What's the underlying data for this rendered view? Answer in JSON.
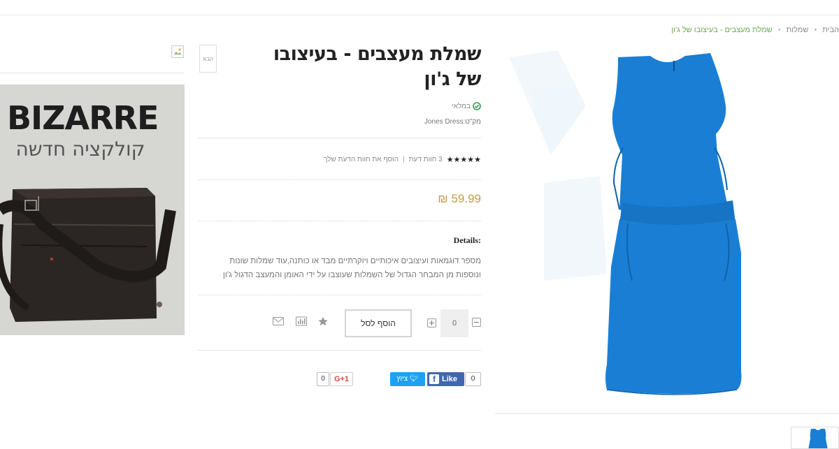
{
  "breadcrumb": {
    "home": "הבית",
    "category": "שמלות",
    "current": "שמלת מעצבים - בעיצובו של ג'ון"
  },
  "product": {
    "title": "שמלת מעצבים - בעיצובו של ג'ון",
    "next_label": "הבא",
    "stock": "במלאי",
    "sku": "מק\"ט:Jones Dress",
    "rating_stars": 5,
    "reviews_text": "3 חוות דעת",
    "add_review": "הוסף את חוות הדעת שלך",
    "price": "59.99 ₪",
    "details_heading": "Details:",
    "description_line1": "מספר דוגמאות ועיצובים איכותיים ויוקרתיים מבד או כותנה,עוד שמלות שונות",
    "description_line2": "ונוספות מן המבחר הגדול של השמלות שעוצבו על ידי האומן והמעצב הדגול ג'ון",
    "quantity": "0",
    "add_to_cart": "הוסף לסל",
    "icons": [
      "wishlist-star-icon",
      "compare-chart-icon",
      "email-icon"
    ]
  },
  "share": {
    "fb_count": "0",
    "fb_label": "Like",
    "tweet_label": "ציוץ",
    "gplus_label": "G+1",
    "gplus_count": "0"
  },
  "banner": {
    "brand": "BIZARRE",
    "subtitle": "קולקציה חדשה"
  },
  "colors": {
    "dress_blue": "#1a7fd4",
    "price_gold": "#c79a4b",
    "breadcrumb_green": "#6aa84f",
    "facebook": "#4267b2",
    "twitter": "#1da1f2",
    "gplus": "#dd4b39"
  }
}
